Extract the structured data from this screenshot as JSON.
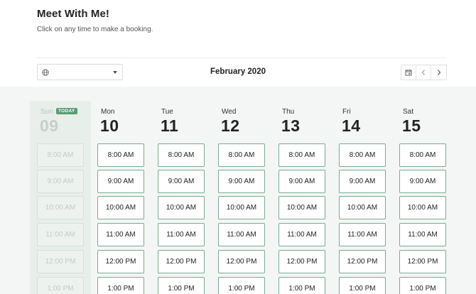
{
  "header": {
    "title": "Meet With Me!",
    "subtitle": "Click on any time to make a booking."
  },
  "toolbar": {
    "timezone_icon": "globe-icon",
    "month_label": "February 2020",
    "calendar_icon": "calendar-icon",
    "prev_icon": "chevron-left-icon",
    "next_icon": "chevron-right-icon"
  },
  "colors": {
    "accent": "#5b9a78",
    "slot_border": "#77ad92",
    "band_bg": "#f3f6f4"
  },
  "days": [
    {
      "name": "Sun",
      "num": "09",
      "today": true,
      "badge": "TODAY",
      "slots": [
        "8:00 AM",
        "9:00 AM",
        "10:00 AM",
        "11:00 AM",
        "12:00 PM",
        "1:00 PM"
      ]
    },
    {
      "name": "Mon",
      "num": "10",
      "today": false,
      "slots": [
        "8:00 AM",
        "9:00 AM",
        "10:00 AM",
        "11:00 AM",
        "12:00 PM",
        "1:00 PM"
      ]
    },
    {
      "name": "Tue",
      "num": "11",
      "today": false,
      "slots": [
        "8:00 AM",
        "9:00 AM",
        "10:00 AM",
        "11:00 AM",
        "12:00 PM",
        "1:00 PM"
      ]
    },
    {
      "name": "Wed",
      "num": "12",
      "today": false,
      "slots": [
        "8:00 AM",
        "9:00 AM",
        "10:00 AM",
        "11:00 AM",
        "12:00 PM",
        "1:00 PM"
      ]
    },
    {
      "name": "Thu",
      "num": "13",
      "today": false,
      "slots": [
        "8:00 AM",
        "9:00 AM",
        "10:00 AM",
        "11:00 AM",
        "12:00 PM",
        "1:00 PM"
      ]
    },
    {
      "name": "Fri",
      "num": "14",
      "today": false,
      "slots": [
        "8:00 AM",
        "9:00 AM",
        "10:00 AM",
        "11:00 AM",
        "12:00 PM",
        "1:00 PM"
      ]
    },
    {
      "name": "Sat",
      "num": "15",
      "today": false,
      "slots": [
        "8:00 AM",
        "9:00 AM",
        "10:00 AM",
        "11:00 AM",
        "12:00 PM",
        "1:00 PM"
      ]
    }
  ]
}
